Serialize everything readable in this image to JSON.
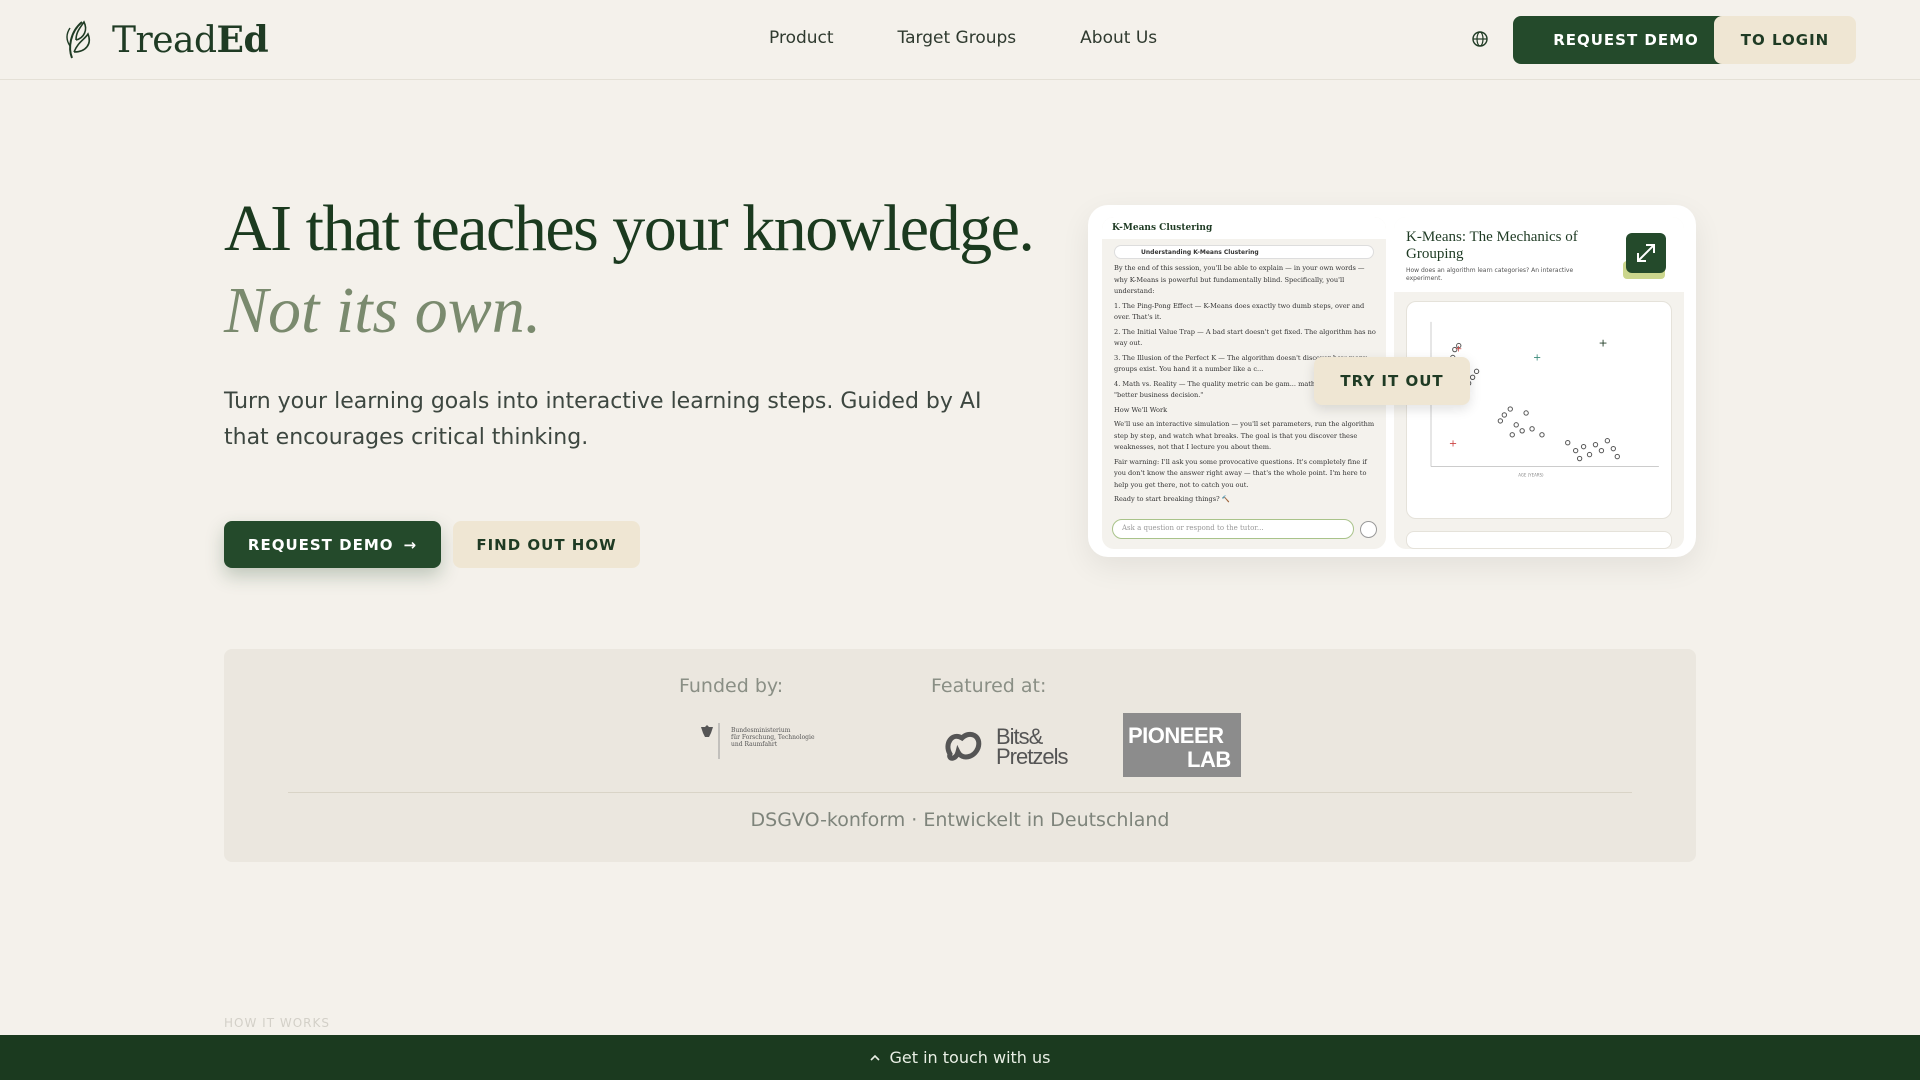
{
  "header": {
    "logo_text_light": "Tread",
    "logo_text_bold": "Ed",
    "nav": [
      "Product",
      "Target Groups",
      "About Us"
    ],
    "request_demo": "REQUEST DEMO",
    "login": "TO LOGIN"
  },
  "hero": {
    "title": "AI that teaches your knowledge.",
    "subtitle": "Not its own.",
    "description": "Turn your learning goals into interactive learning steps. Guided by AI that encourages critical thinking.",
    "primary_button": "REQUEST DEMO",
    "primary_arrow": "→",
    "secondary_button": "FIND OUT HOW"
  },
  "preview": {
    "left_title": "K-Means Clustering",
    "left_sub": "Understanding K-Means Clustering",
    "intro": "By the end of this session, you'll be able to explain — in your own words — why K-Means is powerful but fundamentally blind. Specifically, you'll understand:",
    "points": [
      "1. The Ping-Pong Effect — K-Means does exactly two dumb steps, over and over. That's it.",
      "2. The Initial Value Trap — A bad start doesn't get fixed. The algorithm has no way out.",
      "3. The Illusion of the Perfect K — The algorithm doesn't discover how many groups exist. You hand it a number like a c...",
      "4. Math vs. Reality — The quality metric can be gam... math\" doesn't mean \"better business decision.\""
    ],
    "how_heading": "How We'll Work",
    "how_text": "We'll use an interactive simulation — you'll set parameters, run the algorithm step by step, and watch what breaks. The goal is that you discover these weaknesses, not that I lecture you about them.",
    "warning": "Fair warning: I'll ask you some provocative questions. It's completely fine if you don't know the answer right away — that's the whole point. I'm here to help you get there, not to catch you out.",
    "ready": "Ready to start breaking things? 🔨",
    "input_placeholder": "Ask a question or respond to the tutor...",
    "right_title": "K-Means: The Mechanics of Grouping",
    "right_question": "How does an algorithm learn categories? An interactive experiment.",
    "x_axis": "AGE (YEARS)",
    "try_it": "TRY IT OUT"
  },
  "strip": {
    "funded_label": "Funded by:",
    "featured_label": "Featured at:",
    "bmbf_lines": [
      "Bundesministerium",
      "für Forschung, Technologie",
      "und Raumfahrt"
    ],
    "bp_line1": "Bits&",
    "bp_line2": "Pretzels",
    "pioneer_line1": "PIONEER",
    "pioneer_line2": "LAB",
    "note": "DSGVO-konform · Entwickelt in Deutschland"
  },
  "section_label": "HOW IT WORKS",
  "footer": {
    "contact": "Get in touch with us"
  },
  "colors": {
    "brand_dark": "#244a2b",
    "cream": "#efe6d3",
    "background": "#f4f1eb",
    "footer": "#1b3a1f"
  }
}
